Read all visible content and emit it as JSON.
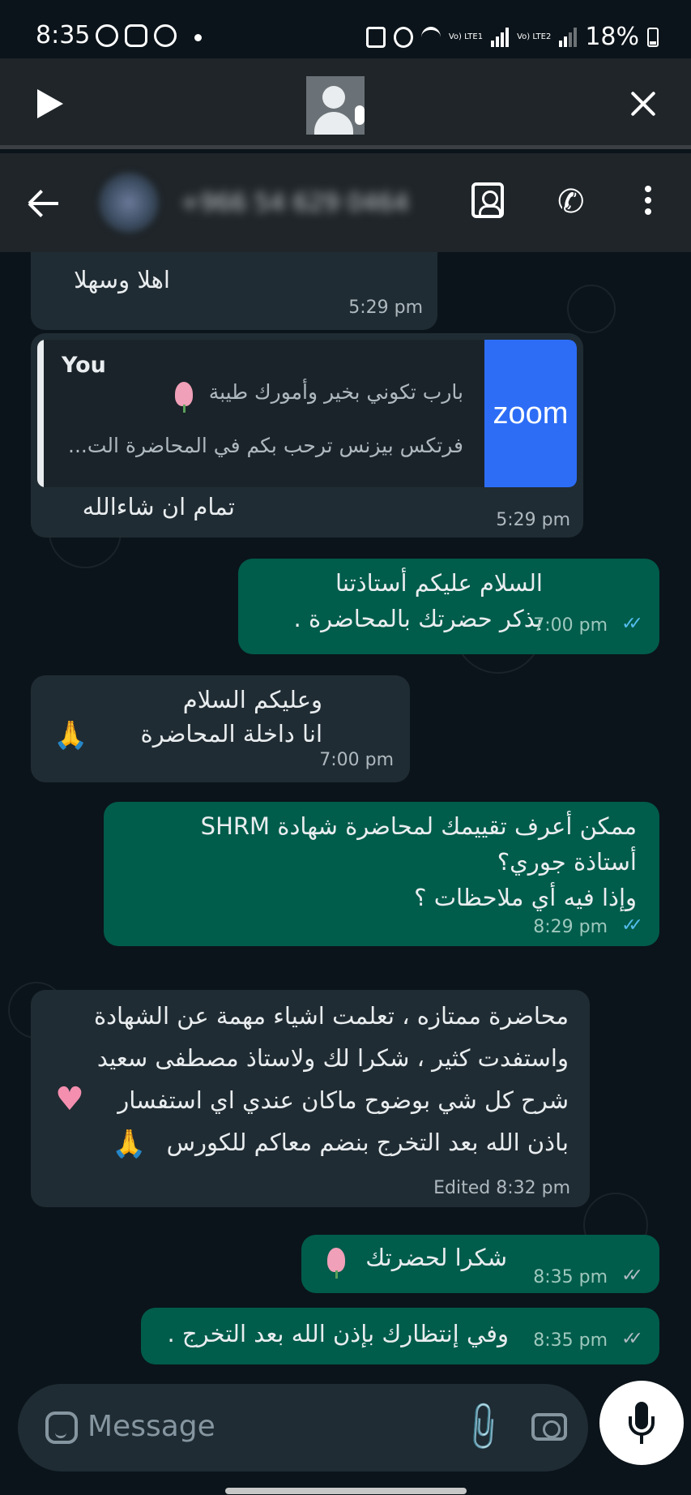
{
  "status_bar": {
    "time": "8:35",
    "battery": "18%",
    "sim1": "Vo) LTE1",
    "sim2": "Vo) LTE2"
  },
  "header": {
    "contact_name": "+966 54 629 0464",
    "icons": [
      "back-arrow-icon",
      "contact-card-icon",
      "add-call-icon",
      "more-options-icon"
    ]
  },
  "messages": [
    {
      "dir": "in",
      "text": "اهلا وسهلا",
      "time": "5:29 pm"
    },
    {
      "dir": "in",
      "reply": {
        "sender": "You",
        "line1": "بارب تكوني بخير وأمورك طيبة",
        "line2": "فرتكس بيزنس ترحب بكم في المحاضرة الت...",
        "thumb": "zoom"
      },
      "text": "تمام ان شاءالله",
      "time": "5:29 pm"
    },
    {
      "dir": "out",
      "line1": "السلام عليكم أستاذتنا",
      "line2": "بذكر حضرتك بالمحاضرة .",
      "time": "7:00 pm",
      "ticks": "✓✓"
    },
    {
      "dir": "in",
      "line1": "وعليكم السلام",
      "line2": "انا داخلة المحاضرة",
      "time": "7:00 pm"
    },
    {
      "dir": "out",
      "line1": "ممكن أعرف تقييمك لمحاضرة شهادة SHRM",
      "line2": "أستاذة جوري؟",
      "line3": "وإذا فيه أي ملاحظات ؟",
      "time": "8:29 pm",
      "ticks": "✓✓"
    },
    {
      "dir": "in",
      "line1": "محاضرة ممتازه ، تعلمت اشياء مهمة عن الشهادة",
      "line2": "واستفدت كثير ، شكرا لك ولاستاذ مصطفى سعيد",
      "line3": "شرح كل شي بوضوح ماكان عندي اي استفسار",
      "line4": "باذن الله بعد التخرج بنضم معاكم للكورس",
      "time": "Edited 8:32 pm"
    },
    {
      "dir": "out",
      "text": "شكرا لحضرتك",
      "time": "8:35 pm",
      "ticks": "✓✓"
    },
    {
      "dir": "out",
      "text": "وفي إنتظارك بإذن الله بعد التخرج .",
      "time": "8:35 pm",
      "ticks": "✓✓"
    }
  ],
  "composer": {
    "placeholder": "Message"
  },
  "colors": {
    "background": "#0b141a",
    "incoming": "#202c33",
    "outgoing": "#005c4b",
    "read_ticks": "#53bdeb"
  }
}
